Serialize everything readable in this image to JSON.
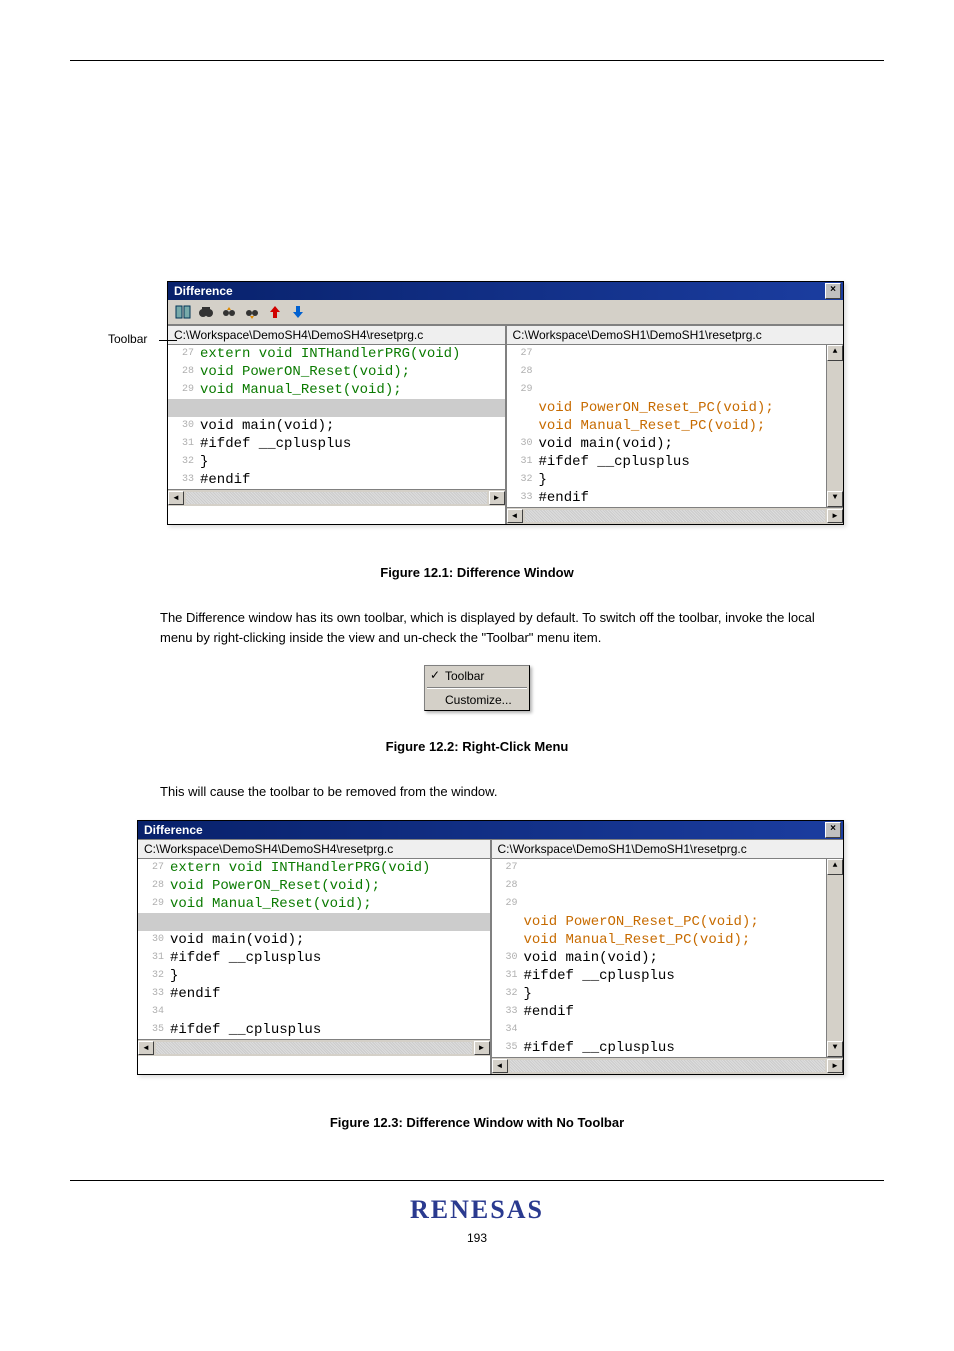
{
  "toolbar_side_label": "Toolbar",
  "window1": {
    "title": "Difference",
    "left": {
      "path": "C:\\Workspace\\DemoSH4\\DemoSH4\\resetprg.c",
      "lines": [
        {
          "n": "27",
          "t": "extern void INTHandlerPRG(void)",
          "cls": "green"
        },
        {
          "n": "28",
          "t": "void PowerON_Reset(void);",
          "cls": "green"
        },
        {
          "n": "29",
          "t": "void Manual_Reset(void);",
          "cls": "green"
        },
        {
          "n": "",
          "t": "",
          "cls": "sel"
        },
        {
          "n": "30",
          "t": "void main(void);",
          "cls": "black"
        },
        {
          "n": "31",
          "t": "#ifdef __cplusplus",
          "cls": "black"
        },
        {
          "n": "32",
          "t": "}",
          "cls": "black"
        },
        {
          "n": "33",
          "t": "#endif",
          "cls": "black"
        }
      ]
    },
    "right": {
      "path": "C:\\Workspace\\DemoSH1\\DemoSH1\\resetprg.c",
      "lines": [
        {
          "n": "27",
          "t": "",
          "cls": "green"
        },
        {
          "n": "28",
          "t": "",
          "cls": "green"
        },
        {
          "n": "29",
          "t": "",
          "cls": "green"
        },
        {
          "n": "",
          "t": "void PowerON_Reset_PC(void);",
          "cls": "orange"
        },
        {
          "n": "",
          "t": "void Manual_Reset_PC(void);",
          "cls": "orange"
        },
        {
          "n": "30",
          "t": "void main(void);",
          "cls": "black"
        },
        {
          "n": "31",
          "t": "#ifdef __cplusplus",
          "cls": "black"
        },
        {
          "n": "32",
          "t": "}",
          "cls": "black"
        },
        {
          "n": "33",
          "t": "#endif",
          "cls": "black"
        }
      ]
    }
  },
  "caption1": "Figure 12.1: Difference Window",
  "para1": "The Difference window has its own toolbar, which is displayed by default. To switch off the toolbar, invoke the local menu by right-clicking inside the view and un-check the \"Toolbar\" menu item.",
  "ctx_menu": {
    "item1": "Toolbar",
    "item2": "Customize..."
  },
  "caption_menu": "Figure 12.2: Right-Click Menu",
  "para2": "This will cause the toolbar to be removed from the window.",
  "window2": {
    "title": "Difference",
    "left": {
      "path": "C:\\Workspace\\DemoSH4\\DemoSH4\\resetprg.c",
      "lines": [
        {
          "n": "27",
          "t": "extern void INTHandlerPRG(void)",
          "cls": "green"
        },
        {
          "n": "28",
          "t": "void PowerON_Reset(void);",
          "cls": "green"
        },
        {
          "n": "29",
          "t": "void Manual_Reset(void);",
          "cls": "green"
        },
        {
          "n": "",
          "t": "",
          "cls": "sel"
        },
        {
          "n": "30",
          "t": "void main(void);",
          "cls": "black"
        },
        {
          "n": "31",
          "t": "#ifdef __cplusplus",
          "cls": "black"
        },
        {
          "n": "32",
          "t": "}",
          "cls": "black"
        },
        {
          "n": "33",
          "t": "#endif",
          "cls": "black"
        },
        {
          "n": "34",
          "t": "",
          "cls": "black"
        },
        {
          "n": "35",
          "t": "#ifdef __cplusplus",
          "cls": "black"
        }
      ]
    },
    "right": {
      "path": "C:\\Workspace\\DemoSH1\\DemoSH1\\resetprg.c",
      "lines": [
        {
          "n": "27",
          "t": "",
          "cls": "green"
        },
        {
          "n": "28",
          "t": "",
          "cls": "green"
        },
        {
          "n": "29",
          "t": "",
          "cls": "green"
        },
        {
          "n": "",
          "t": "void PowerON_Reset_PC(void);",
          "cls": "orange"
        },
        {
          "n": "",
          "t": "void Manual_Reset_PC(void);",
          "cls": "orange"
        },
        {
          "n": "30",
          "t": "void main(void);",
          "cls": "black"
        },
        {
          "n": "31",
          "t": "#ifdef __cplusplus",
          "cls": "black"
        },
        {
          "n": "32",
          "t": "}",
          "cls": "black"
        },
        {
          "n": "33",
          "t": "#endif",
          "cls": "black"
        },
        {
          "n": "34",
          "t": "",
          "cls": "black"
        },
        {
          "n": "35",
          "t": "#ifdef __cplusplus",
          "cls": "black"
        }
      ]
    }
  },
  "caption2": "Figure 12.3: Difference Window with No Toolbar",
  "footer": {
    "brand": "RENESAS",
    "page": "193"
  }
}
